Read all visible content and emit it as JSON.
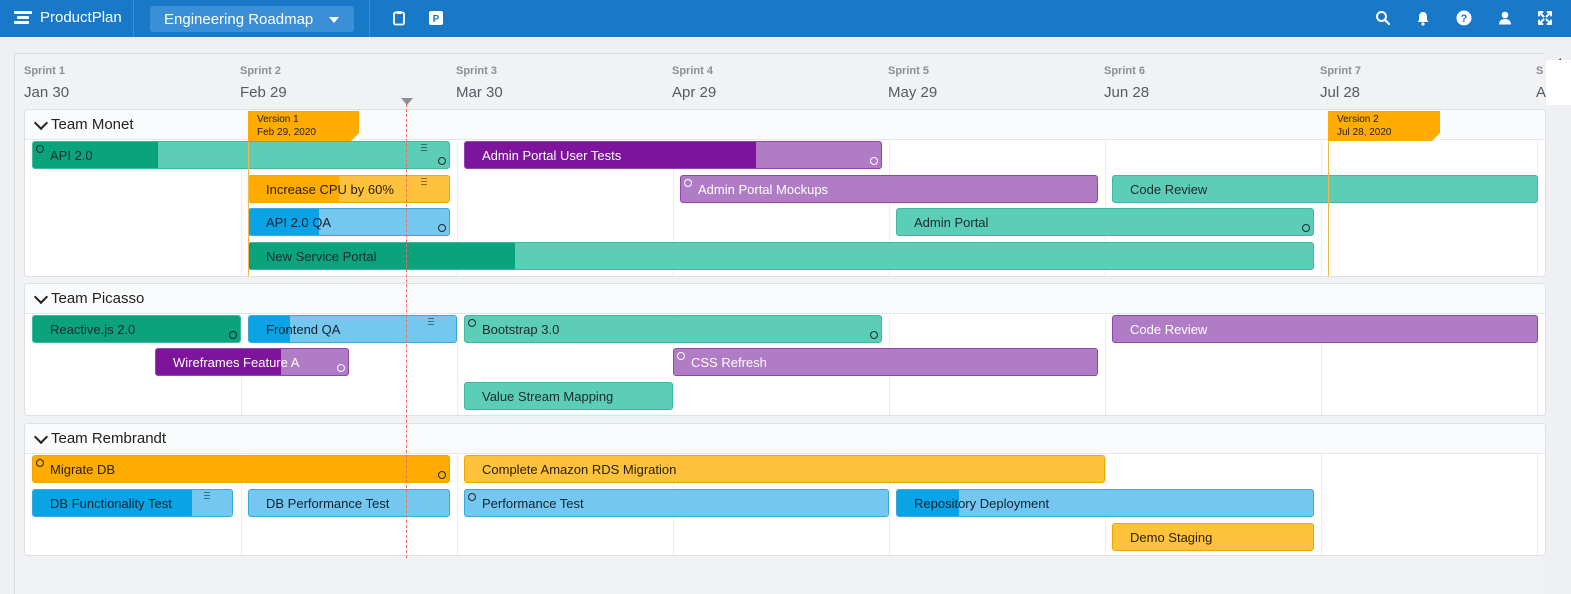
{
  "app": {
    "name": "ProductPlan",
    "roadmap": "Engineering Roadmap"
  },
  "icons": {
    "logo": "productplan-logo-icon",
    "toolbar": [
      "clipboard-icon",
      "parking-lot-icon"
    ],
    "right": [
      "search-icon",
      "bell-icon",
      "help-icon",
      "user-icon",
      "fullscreen-icon"
    ]
  },
  "colors": {
    "header": "#1779c7",
    "teal": "#5ccdb6",
    "teal_dark": "#0ba37c",
    "purple": "#b07cc6",
    "purple_dark": "#7d149b",
    "orange": "#ffc23c",
    "orange_dark": "#ffab00",
    "blue": "#74c7ef",
    "blue_dark": "#0aa3e5",
    "today": "#f26d5b"
  },
  "timeline": [
    {
      "sprint": "Sprint 1",
      "date": "Jan 30"
    },
    {
      "sprint": "Sprint 2",
      "date": "Feb 29"
    },
    {
      "sprint": "Sprint 3",
      "date": "Mar 30"
    },
    {
      "sprint": "Sprint 4",
      "date": "Apr 29"
    },
    {
      "sprint": "Sprint 5",
      "date": "May 29"
    },
    {
      "sprint": "Sprint 6",
      "date": "Jun 28"
    },
    {
      "sprint": "Sprint 7",
      "date": "Jul 28"
    },
    {
      "sprint": "S",
      "date": "A"
    }
  ],
  "milestones": [
    {
      "name": "Version 1",
      "date": "Feb 29, 2020"
    },
    {
      "name": "Version 2",
      "date": "Jul 28, 2020"
    }
  ],
  "lanes": [
    {
      "title": "Team Monet",
      "bars": [
        {
          "label": "API 2.0",
          "color": "teal",
          "progress": 0.3
        },
        {
          "label": "Admin Portal User Tests",
          "color": "purple",
          "progress": 0.7
        },
        {
          "label": "Increase CPU by 60%",
          "color": "orange",
          "progress": 0.45
        },
        {
          "label": "Admin Portal Mockups",
          "color": "purple",
          "progress": 0
        },
        {
          "label": "Code Review",
          "color": "teal",
          "progress": 0
        },
        {
          "label": "API 2.0 QA",
          "color": "blue",
          "progress": 0.35
        },
        {
          "label": "Admin Portal",
          "color": "teal",
          "progress": 0
        },
        {
          "label": "New Service Portal",
          "color": "teal",
          "progress": 0.25
        }
      ]
    },
    {
      "title": "Team Picasso",
      "bars": [
        {
          "label": "Reactive.js 2.0",
          "color": "teal",
          "progress": 1
        },
        {
          "label": "Frontend QA",
          "color": "blue",
          "progress": 0.2
        },
        {
          "label": "Bootstrap 3.0",
          "color": "teal",
          "progress": 0
        },
        {
          "label": "Code Review",
          "color": "purple",
          "progress": 0
        },
        {
          "label": "Wireframes Feature A",
          "color": "purple",
          "progress": 0.65
        },
        {
          "label": "CSS Refresh",
          "color": "purple",
          "progress": 0
        },
        {
          "label": "Value Stream Mapping",
          "color": "teal",
          "progress": 0
        }
      ]
    },
    {
      "title": "Team Rembrandt",
      "bars": [
        {
          "label": "Migrate DB",
          "color": "orange",
          "progress": 1
        },
        {
          "label": "Complete Amazon RDS Migration",
          "color": "orange",
          "progress": 0
        },
        {
          "label": "DB Functionality Test",
          "color": "blue",
          "progress": 0.8
        },
        {
          "label": "DB Performance Test",
          "color": "blue",
          "progress": 0
        },
        {
          "label": "Performance Test",
          "color": "blue",
          "progress": 0
        },
        {
          "label": "Repository Deployment",
          "color": "blue",
          "progress": 0.15
        },
        {
          "label": "Demo Staging",
          "color": "orange",
          "progress": 0
        }
      ]
    }
  ]
}
